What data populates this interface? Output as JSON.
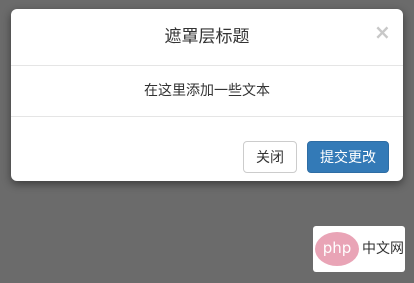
{
  "modal": {
    "title": "遮罩层标题",
    "close_glyph": "×",
    "body_text": "在这里添加一些文本",
    "buttons": {
      "close_label": "关闭",
      "submit_label": "提交更改"
    }
  },
  "watermark": {
    "logo_text": "php",
    "site_text": "中文网"
  },
  "colors": {
    "backdrop": "#6b6b6b",
    "primary": "#337ab7",
    "primary_border": "#2e6da4",
    "divider": "#e5e5e5",
    "logo": "#e9a4b6"
  }
}
